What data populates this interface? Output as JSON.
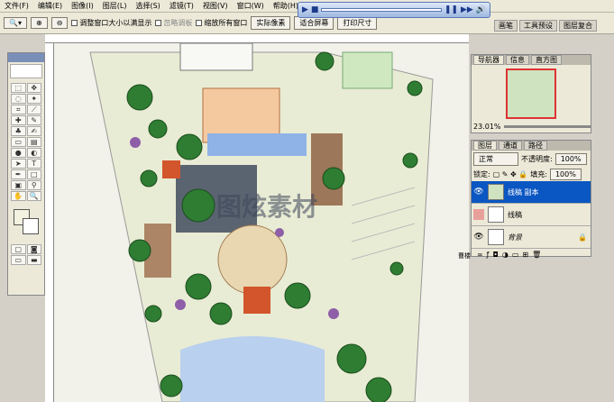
{
  "menu": [
    "文件(F)",
    "编辑(E)",
    "图像(I)",
    "图层(L)",
    "选择(S)",
    "滤镜(T)",
    "视图(V)",
    "窗口(W)",
    "帮助(H)"
  ],
  "options": {
    "resize_label": "调整窗口大小以满显示",
    "ignore_palettes": "忽略调板",
    "zoom_all": "缩放所有窗口",
    "actual_pixels": "实际像素",
    "fit_screen": "适合屏幕",
    "print_size": "打印尺寸"
  },
  "right_tabs": [
    "画笔",
    "工具预设",
    "图层复合"
  ],
  "navigator": {
    "tabs": [
      "导航器",
      "信息",
      "直方图"
    ],
    "zoom": "23.01%"
  },
  "layers_panel": {
    "tabs": [
      "图层",
      "通道",
      "路径"
    ],
    "blend_mode": "正常",
    "opacity_label": "不透明度:",
    "opacity_value": "100%",
    "lock_label": "锁定:",
    "fill_label": "填充:",
    "fill_value": "100%",
    "layers": [
      {
        "name": "线稿 副本"
      },
      {
        "name": "线稿"
      },
      {
        "name": "背景"
      }
    ]
  },
  "watermark_text": "图炫素材",
  "side_label": "曹楼",
  "colors": {
    "accent_blue": "#0a56c2",
    "plaza_orange": "#c97a3b",
    "water_blue": "#8fb3e6",
    "tree_green": "#2e7d32"
  }
}
